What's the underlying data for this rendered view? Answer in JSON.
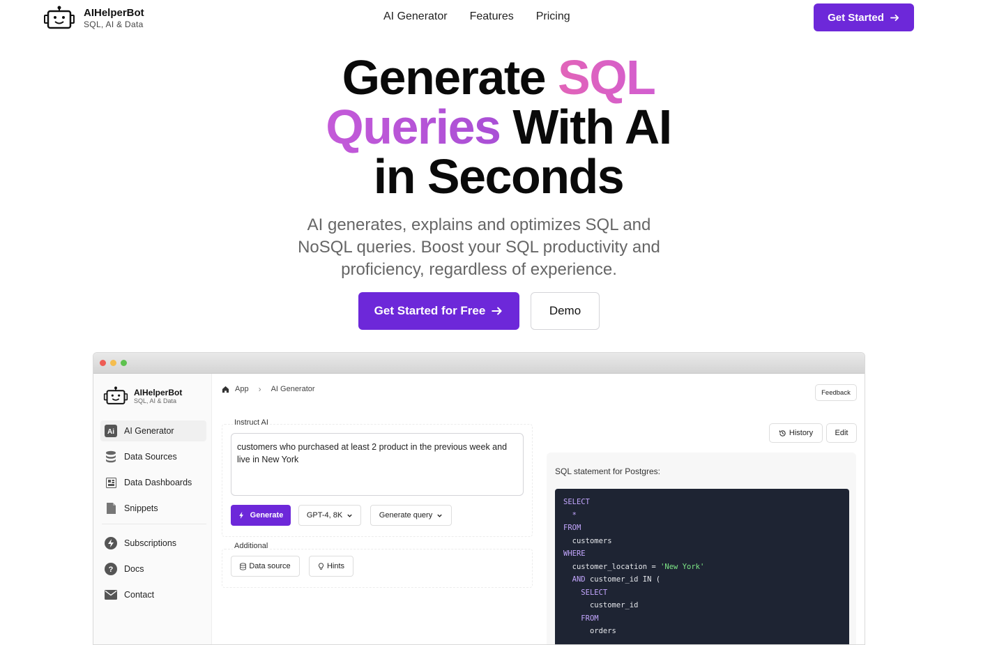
{
  "nav": {
    "brand_name": "AIHelperBot",
    "brand_tagline": "SQL, AI & Data",
    "links": [
      "AI Generator",
      "Features",
      "Pricing"
    ],
    "cta": "Get Started"
  },
  "hero": {
    "title_line1_plain": "Generate ",
    "title_line1_accent": "SQL",
    "title_line2_accent": "Queries",
    "title_line2_plain": " With AI",
    "title_line3": "in Seconds",
    "subtitle": "AI generates, explains and optimizes SQL and NoSQL queries. Boost your SQL productivity and proficiency, regardless of experience.",
    "primary_cta": "Get Started for Free",
    "secondary_cta": "Demo"
  },
  "app": {
    "sidebar": {
      "brand_name": "AIHelperBot",
      "brand_tagline": "SQL, AI & Data",
      "items": [
        {
          "label": "AI Generator",
          "icon": "ai-icon"
        },
        {
          "label": "Data Sources",
          "icon": "database-icon"
        },
        {
          "label": "Data Dashboards",
          "icon": "dashboard-icon"
        },
        {
          "label": "Snippets",
          "icon": "snippet-icon"
        },
        {
          "label": "Subscriptions",
          "icon": "lightning-icon"
        },
        {
          "label": "Docs",
          "icon": "help-icon"
        },
        {
          "label": "Contact",
          "icon": "mail-icon"
        }
      ]
    },
    "breadcrumb": [
      "App",
      "AI Generator"
    ],
    "feedback": "Feedback",
    "instruct_label": "Instruct AI",
    "instruction": "customers who purchased at least 2 product in the previous week and live in New York",
    "generate": "Generate",
    "model": "GPT-4, 8K",
    "mode": "Generate query",
    "additional_label": "Additional",
    "data_source": "Data source",
    "hints": "Hints",
    "history": "History",
    "edit": "Edit",
    "result_label": "SQL statement for Postgres:",
    "sql_lines": [
      {
        "indent": 0,
        "kw": "SELECT",
        "text": "",
        "str": ""
      },
      {
        "indent": 1,
        "kw": "*",
        "text": "",
        "str": ""
      },
      {
        "indent": 0,
        "kw": "FROM",
        "text": "",
        "str": ""
      },
      {
        "indent": 1,
        "kw": "",
        "text": "customers",
        "str": ""
      },
      {
        "indent": 0,
        "kw": "WHERE",
        "text": "",
        "str": ""
      },
      {
        "indent": 1,
        "kw": "",
        "text": "customer_location = ",
        "str": "'New York'"
      },
      {
        "indent": 1,
        "kw": "AND",
        "text": " customer_id IN (",
        "str": ""
      },
      {
        "indent": 2,
        "kw": "SELECT",
        "text": "",
        "str": ""
      },
      {
        "indent": 3,
        "kw": "",
        "text": "customer_id",
        "str": ""
      },
      {
        "indent": 2,
        "kw": "FROM",
        "text": "",
        "str": ""
      },
      {
        "indent": 3,
        "kw": "",
        "text": "orders",
        "str": ""
      }
    ]
  },
  "colors": {
    "accent": "#6d28d9",
    "gradient_pink": "#e264b8",
    "gradient_purple": "#a94fd6",
    "code_bg": "#1e2433"
  }
}
